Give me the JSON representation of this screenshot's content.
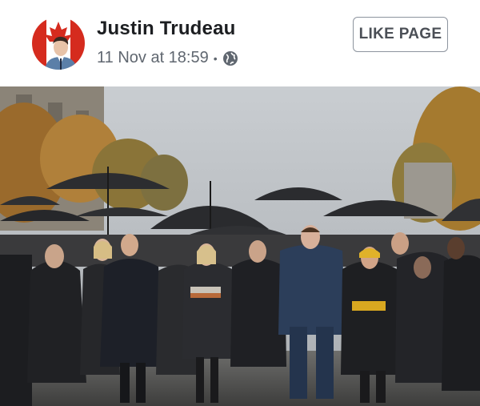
{
  "post": {
    "author": "Justin Trudeau",
    "date": "11 Nov at 18:59",
    "separator": "•",
    "audience_icon": "globe-icon",
    "like_button": "LIKE PAGE"
  },
  "photo": {
    "subject": "world leaders walking under black umbrellas"
  },
  "colors": {
    "author_text": "#1c1e21",
    "meta_text": "#606770",
    "button_border": "#8d949e",
    "flag_red": "#d52b1e"
  }
}
